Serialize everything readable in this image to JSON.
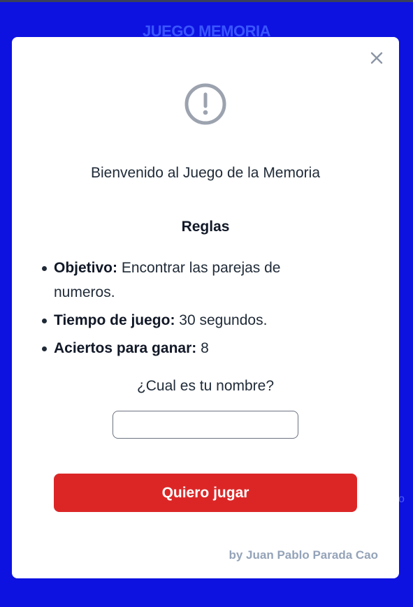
{
  "background": {
    "title": "JUEGO MEMORIA",
    "right_text": "o"
  },
  "modal": {
    "close_icon": "close-icon",
    "alert_icon": "exclamation-circle-icon",
    "welcome": "Bienvenido al Juego de la Memoria",
    "rules_title": "Reglas",
    "rules": [
      {
        "label": "Objetivo:",
        "text": " Encontrar las parejas de numeros."
      },
      {
        "label": "Tiempo de juego:",
        "text": " 30 segundos."
      },
      {
        "label": "Aciertos para ganar:",
        "text": " 8"
      }
    ],
    "name_question": "¿Cual es tu nombre?",
    "name_input": {
      "value": "",
      "placeholder": ""
    },
    "play_button": "Quiero jugar",
    "credit": "by Juan Pablo Parada Cao"
  },
  "colors": {
    "background": "#0d12e0",
    "button": "#dc2626",
    "icon_gray": "#9ca3af"
  }
}
